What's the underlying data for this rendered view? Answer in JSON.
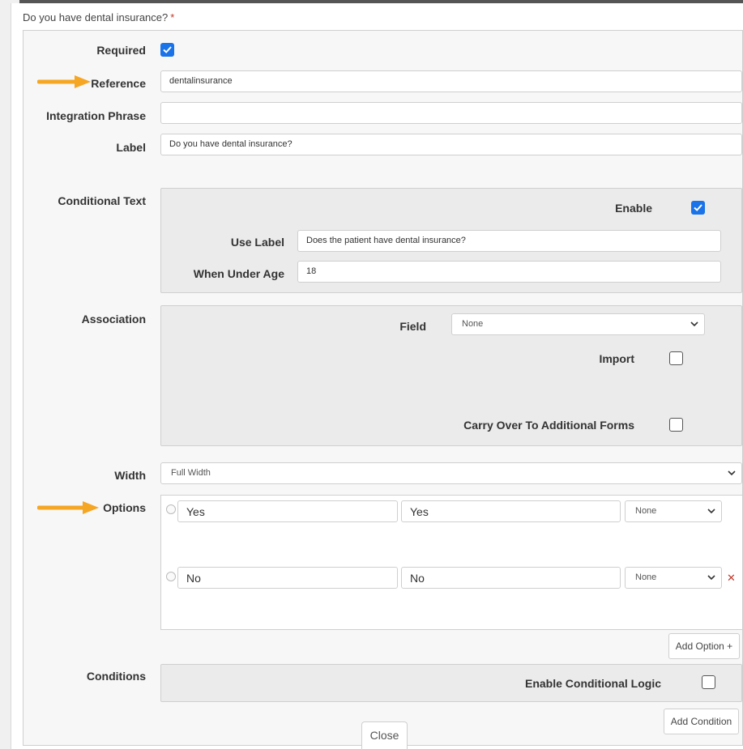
{
  "question": {
    "title": "Do you have dental insurance?",
    "required_marker": "*"
  },
  "fields": {
    "required": {
      "label": "Required",
      "checked": true
    },
    "reference": {
      "label": "Reference",
      "value": "dentalinsurance"
    },
    "integration_phrase": {
      "label": "Integration Phrase",
      "value": ""
    },
    "label": {
      "label": "Label",
      "value": "Do you have dental insurance?"
    }
  },
  "conditional_text": {
    "label": "Conditional Text",
    "enable_label": "Enable",
    "enabled": true,
    "use_label": {
      "label": "Use Label",
      "value": "Does the patient have dental insurance?"
    },
    "under_age": {
      "label": "When Under Age",
      "value": "18"
    }
  },
  "association": {
    "label": "Association",
    "field": {
      "label": "Field",
      "value": "None"
    },
    "import": {
      "label": "Import",
      "checked": false
    },
    "carry_over": {
      "label": "Carry Over To Additional Forms",
      "checked": false
    }
  },
  "width": {
    "label": "Width",
    "value": "Full Width"
  },
  "options": {
    "label": "Options",
    "items": [
      {
        "text": "Yes",
        "value": "Yes",
        "select": "None"
      },
      {
        "text": "No",
        "value": "No",
        "select": "None"
      }
    ],
    "add_label": "Add Option +"
  },
  "conditions": {
    "label": "Conditions",
    "enable_label": "Enable Conditional Logic",
    "enabled": false,
    "add_label": "Add Condition"
  },
  "close_label": "Close",
  "colors": {
    "accent": "#1a73e8",
    "arrow": "#f5a623",
    "required": "#c0392b"
  },
  "icons": [
    "checkbox-checked-icon",
    "checkbox-empty-icon",
    "chevron-down-icon",
    "radio-icon",
    "remove-x-icon",
    "arrow-right-icon"
  ]
}
